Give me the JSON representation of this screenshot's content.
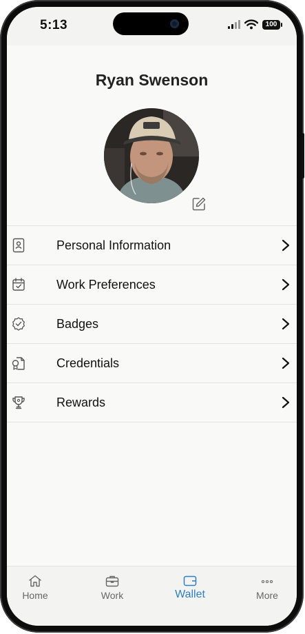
{
  "status_bar": {
    "time": "5:13",
    "battery": "100"
  },
  "profile": {
    "name": "Ryan Swenson"
  },
  "menu": [
    {
      "label": "Personal Information",
      "icon": "id-card-icon"
    },
    {
      "label": "Work Preferences",
      "icon": "calendar-check-icon"
    },
    {
      "label": "Badges",
      "icon": "badge-check-icon"
    },
    {
      "label": "Credentials",
      "icon": "credentials-icon"
    },
    {
      "label": "Rewards",
      "icon": "trophy-icon"
    }
  ],
  "tabs": [
    {
      "label": "Home",
      "icon": "home-icon"
    },
    {
      "label": "Work",
      "icon": "briefcase-icon"
    },
    {
      "label": "Wallet",
      "icon": "wallet-icon",
      "active": true
    },
    {
      "label": "More",
      "icon": "more-dots-icon"
    }
  ],
  "colors": {
    "accent": "#2d7fc1",
    "background": "#f9f9f7",
    "text": "#111111"
  }
}
